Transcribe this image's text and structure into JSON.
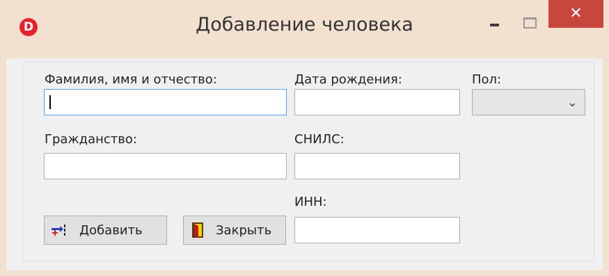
{
  "window": {
    "title": "Добавление человека",
    "app_icon_letter": "D",
    "close_glyph": "✕"
  },
  "form": {
    "full_name": {
      "label": "Фамилия, имя и отчество:",
      "value": ""
    },
    "birth_date": {
      "label": "Дата рождения:",
      "value": ""
    },
    "gender": {
      "label": "Пол:",
      "selected": ""
    },
    "citizenship": {
      "label": "Гражданство:",
      "value": ""
    },
    "snils": {
      "label": "СНИЛС:",
      "value": ""
    },
    "inn": {
      "label": "ИНН:",
      "value": ""
    }
  },
  "buttons": {
    "add": {
      "label": "Добавить",
      "icon": "add-person-icon"
    },
    "close": {
      "label": "Закрыть",
      "icon": "exit-door-icon"
    }
  },
  "colors": {
    "close_button": "#c9463d",
    "app_icon": "#e8202a",
    "focus_border": "#569de5"
  }
}
